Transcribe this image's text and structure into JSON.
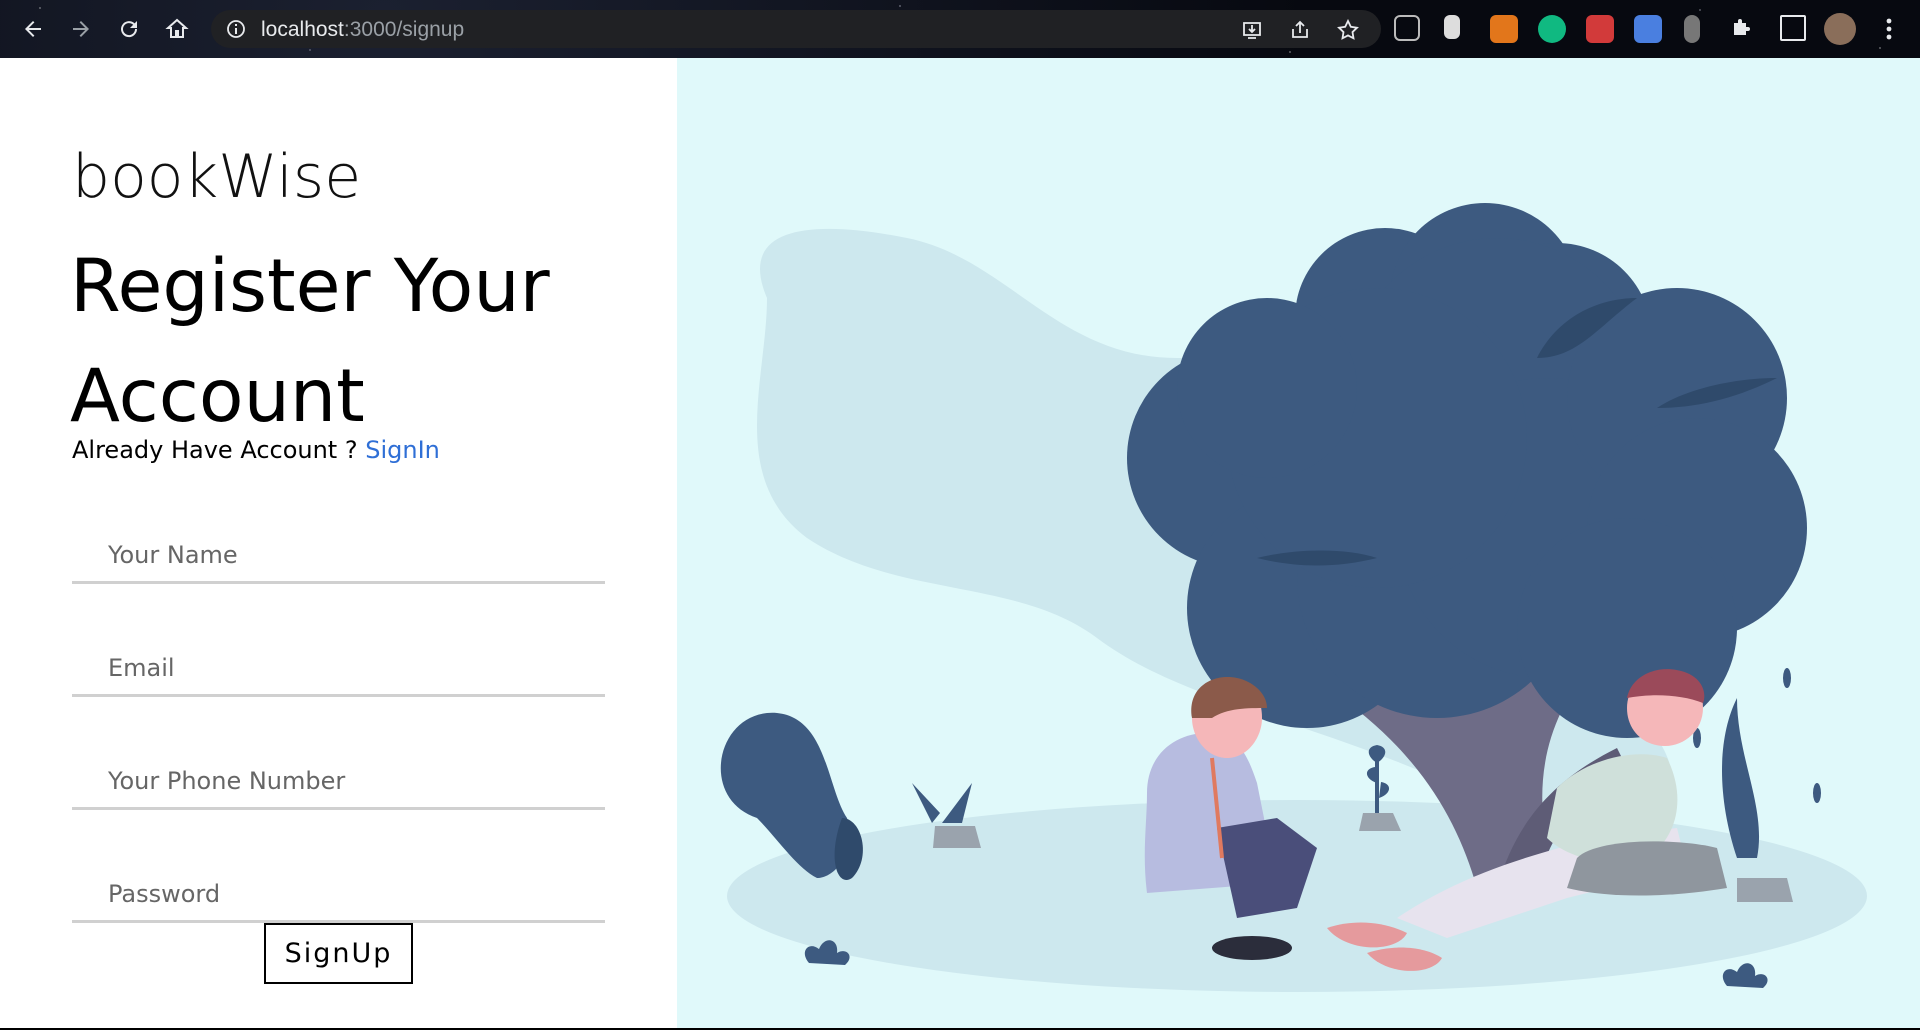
{
  "browser": {
    "url_host": "localhost",
    "url_path": ":3000/signup",
    "icons": [
      "back-arrow-icon",
      "forward-arrow-icon",
      "reload-icon",
      "home-icon",
      "info-icon",
      "install-icon",
      "share-icon",
      "star-icon",
      "profile-avatar"
    ]
  },
  "form": {
    "brand": "bookWise",
    "heading": "Register Your Account",
    "already_text": "Already Have Account ? ",
    "signin_link": "SignIn",
    "name_placeholder": "Your Name",
    "email_placeholder": "Email",
    "phone_placeholder": "Your Phone Number",
    "password_placeholder": "Password",
    "submit_label": "SignUp"
  },
  "colors": {
    "illustration_bg": "#e0f9fa",
    "tree": "#3d5a80",
    "link": "#2f6fd6"
  }
}
